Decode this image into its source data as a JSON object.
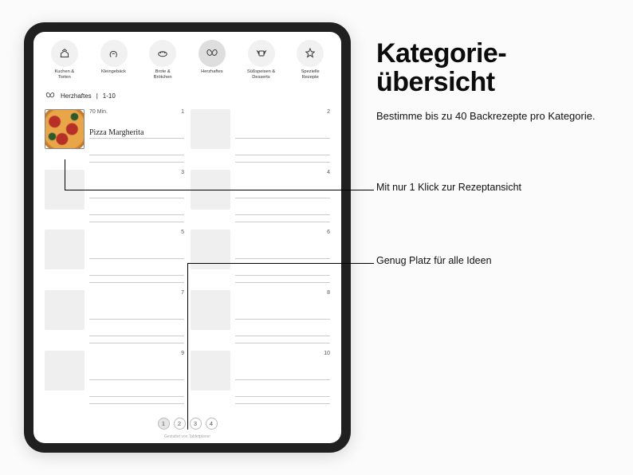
{
  "categories": [
    {
      "id": "kuchen",
      "label": "Kuchen &\nTorten"
    },
    {
      "id": "kleingebaeck",
      "label": "Kleingebäck"
    },
    {
      "id": "brote",
      "label": "Brote &\nBrötchen"
    },
    {
      "id": "herzhaftes",
      "label": "Herzhaftes",
      "active": true
    },
    {
      "id": "suesses",
      "label": "Süßspeisen &\nDesserts"
    },
    {
      "id": "spezielle",
      "label": "Spezielle\nRezepte"
    }
  ],
  "section": {
    "title": "Herzhaftes",
    "range": "1-10"
  },
  "recipes": [
    {
      "num": "1",
      "time": "70 Min.",
      "title": "Pizza Margherita",
      "filled": true
    },
    {
      "num": "2"
    },
    {
      "num": "3"
    },
    {
      "num": "4"
    },
    {
      "num": "5"
    },
    {
      "num": "6"
    },
    {
      "num": "7"
    },
    {
      "num": "8"
    },
    {
      "num": "9"
    },
    {
      "num": "10"
    }
  ],
  "pagination": {
    "pages": [
      "1",
      "2",
      "3",
      "4"
    ],
    "active": "1"
  },
  "footer_credit": "Gestaltet von Tabletplaner",
  "annotations": {
    "title_line1": "Kategorie-",
    "title_line2": "übersicht",
    "subtitle": "Bestimme bis zu 40 Backrezepte pro Kategorie.",
    "a1": "Mit nur 1 Klick zur Rezeptansicht",
    "a2": "Genug Platz für alle Ideen"
  }
}
